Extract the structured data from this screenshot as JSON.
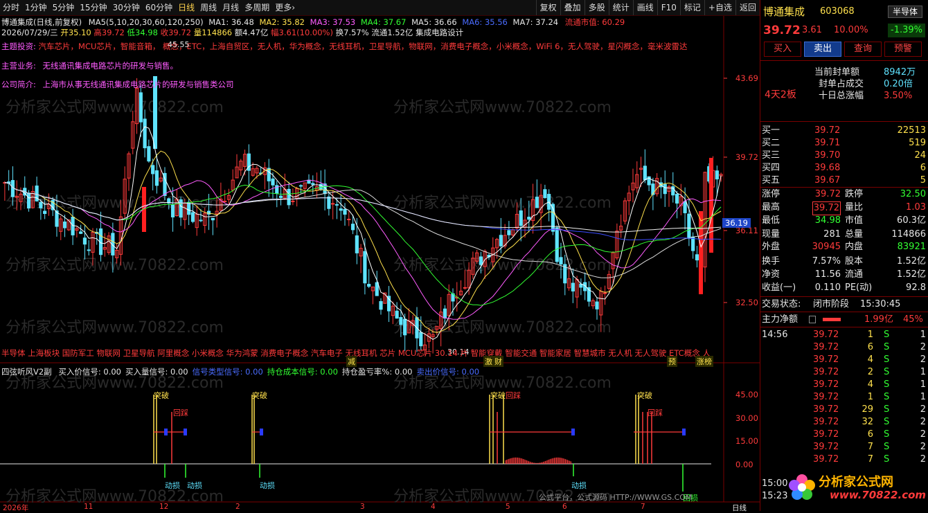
{
  "toolbar": {
    "left": [
      "分时",
      "1分钟",
      "5分钟",
      "15分钟",
      "30分钟",
      "60分钟",
      "日线",
      "周线",
      "月线",
      "多周期",
      "更多›"
    ],
    "active": "日线",
    "right": [
      "复权",
      "叠加",
      "多股",
      "统计",
      "画线",
      "F10",
      "标记",
      "+自选",
      "返回"
    ]
  },
  "header": {
    "title": "博通集成(日线,前复权)",
    "ma_label": "MA5(5,10,20,30,60,120,250)",
    "ma1": "MA1: 36.48",
    "ma2": "MA2: 35.82",
    "ma3": "MA3: 37.53",
    "ma4": "MA4: 37.67",
    "ma5": "MA5: 36.66",
    "ma6": "MA6: 35.56",
    "ma7": "MA7: 37.24",
    "float_cap": "流通市值: 60.29",
    "date": "2026/07/29/三",
    "open": "开35.10",
    "high": "高39.72",
    "low": "低34.98",
    "close": "收39.72",
    "vol": "量114866",
    "amount": "额4.47亿",
    "change": "幅3.61(10.00%)",
    "turnover": "换7.57%",
    "float": "流通1.52亿",
    "concept": "集成电路设计"
  },
  "theme": {
    "label": "主题投资:",
    "text": "汽车芯片，MCU芯片，智能音箱，          概念，ETC，上海自贸区，无人机，华为概念，无线耳机，卫星导航，物联网，消费电子概念，小米概念，WiFi 6，无人驾驶，星闪概念，毫米波雷达",
    "main_label": "主营业务:",
    "main_text": "无线通讯集成电路芯片的研发与销售。",
    "ind_label": "公司简介:",
    "ind_text": "上海市从事无线通讯集成电路芯片的研发与销售类公司",
    "high_mark": "45.55",
    "low_mark": "30.14"
  },
  "watermark": "分析家公式网www.70822.com",
  "price_axis": [
    "43.69",
    "39.72",
    "36.11",
    "32.50"
  ],
  "current_price_tag": "36.19",
  "concepts_bar": "半导体 上海板块 国防军工 物联网 卫星导航 阿里概念 小米概念 华为鸿蒙 消费电子概念 汽车电子 无线耳机 芯片 MCU芯片 30.14 片 智能穿戴 智能交通 智能家居 智慧城市 无人机 无人驾驶 ETC概念 人",
  "event_tags": [
    "减",
    "激",
    "财",
    "预",
    "涨榜"
  ],
  "indicator": {
    "name": "四弦听风V2副",
    "items": [
      {
        "text": "买入价信号: 0.00",
        "color": "#e6e6e6"
      },
      {
        "text": "买入量信号: 0.00",
        "color": "#e6e6e6"
      },
      {
        "text": "信号类型信号: 0.00",
        "color": "#4a6cff"
      },
      {
        "text": "持仓成本信号: 0.00",
        "color": "#32ff32"
      },
      {
        "text": "持仓盈亏率%: 0.00",
        "color": "#e6e6e6"
      },
      {
        "text": "卖出价信号: 0.00",
        "color": "#4a6cff"
      }
    ],
    "axis": [
      "45.00",
      "30.00",
      "15.00",
      "0.00"
    ],
    "labels_break": [
      "突破",
      "突破",
      "突破",
      "突破"
    ],
    "labels_step": [
      "回踩",
      "回踩",
      "回踩"
    ],
    "labels_stop": [
      "动损",
      "动损",
      "动损",
      "动损",
      "回损"
    ]
  },
  "xaxis": [
    "2026年",
    "11",
    "12",
    "2",
    "3",
    "4",
    "5",
    "6",
    "7",
    "日线"
  ],
  "footer_text": "公式平台，公式源码 HTTP://WWW.GS.COM",
  "stock": {
    "name": "博通集成",
    "code": "603068",
    "sector": "半导体",
    "price": "39.72",
    "chg": "3.61",
    "pct": "10.00%",
    "sector_pct": "-1.39%",
    "buttons": [
      "买入",
      "卖出",
      "查询",
      "预警"
    ],
    "limit_days": "4天2板",
    "seal_label": "当前封单额",
    "seal_val": "8942万",
    "seal_ratio_label": "封单占成交",
    "seal_ratio_val": "0.20倍",
    "ten_day_label": "十日总涨幅",
    "ten_day_val": "3.50%"
  },
  "bids": [
    {
      "label": "买一",
      "price": "39.72",
      "vol": "22513"
    },
    {
      "label": "买二",
      "price": "39.71",
      "vol": "519"
    },
    {
      "label": "买三",
      "price": "39.70",
      "vol": "24"
    },
    {
      "label": "买四",
      "price": "39.68",
      "vol": "6"
    },
    {
      "label": "买五",
      "price": "39.67",
      "vol": "5"
    }
  ],
  "quote": [
    {
      "l1": "涨停",
      "v1": "39.72",
      "l2": "跌停",
      "v2": "32.50",
      "c1": "#ff3b3b",
      "c2": "#32ff32"
    },
    {
      "l1": "最高",
      "v1": "39.72",
      "l2": "量比",
      "v2": "1.03",
      "c1": "#ff3b3b",
      "c2": "#ff3b3b"
    },
    {
      "l1": "最低",
      "v1": "34.98",
      "l2": "市值",
      "v2": "60.3亿",
      "c1": "#32ff32",
      "c2": "#e6e6e6"
    },
    {
      "l1": "现量",
      "v1": "281",
      "l2": "总量",
      "v2": "114866",
      "c1": "#e6e6e6",
      "c2": "#e6e6e6"
    },
    {
      "l1": "外盘",
      "v1": "30945",
      "l2": "内盘",
      "v2": "83921",
      "c1": "#ff3b3b",
      "c2": "#32ff32"
    },
    {
      "l1": "换手",
      "v1": "7.57%",
      "l2": "股本",
      "v2": "1.52亿",
      "c1": "#e6e6e6",
      "c2": "#e6e6e6"
    },
    {
      "l1": "净资",
      "v1": "11.56",
      "l2": "流通",
      "v2": "1.52亿",
      "c1": "#e6e6e6",
      "c2": "#e6e6e6"
    },
    {
      "l1": "收益(一)",
      "v1": "0.110",
      "l2": "PE(动)",
      "v2": "92.8",
      "c1": "#e6e6e6",
      "c2": "#e6e6e6"
    }
  ],
  "trade_state_label": "交易状态:",
  "trade_state": "闭市阶段",
  "trade_time": "15:30:45",
  "main_flow_label": "主力净额",
  "main_flow_val": "1.99亿",
  "main_flow_pct": "45%",
  "ticks": [
    {
      "t": "14:56",
      "p": "39.72",
      "v": "1",
      "s": "S",
      "n": "1"
    },
    {
      "t": "",
      "p": "39.72",
      "v": "6",
      "s": "S",
      "n": "2"
    },
    {
      "t": "",
      "p": "39.72",
      "v": "4",
      "s": "S",
      "n": "2"
    },
    {
      "t": "",
      "p": "39.72",
      "v": "2",
      "s": "S",
      "n": "1"
    },
    {
      "t": "",
      "p": "39.72",
      "v": "4",
      "s": "S",
      "n": "1"
    },
    {
      "t": "",
      "p": "39.72",
      "v": "1",
      "s": "S",
      "n": "1"
    },
    {
      "t": "",
      "p": "39.72",
      "v": "29",
      "s": "S",
      "n": "2"
    },
    {
      "t": "",
      "p": "39.72",
      "v": "32",
      "s": "S",
      "n": "2"
    },
    {
      "t": "",
      "p": "39.72",
      "v": "6",
      "s": "S",
      "n": "2"
    },
    {
      "t": "",
      "p": "39.72",
      "v": "7",
      "s": "S",
      "n": "2"
    },
    {
      "t": "",
      "p": "39.72",
      "v": "7",
      "s": "S",
      "n": "2"
    }
  ],
  "tick_times_bottom": [
    "15:00",
    "15:23"
  ],
  "logo": {
    "name": "分析家公式网",
    "url": "www.70822.com"
  },
  "chart_data": {
    "type": "candlestick",
    "note_count": 180
  }
}
